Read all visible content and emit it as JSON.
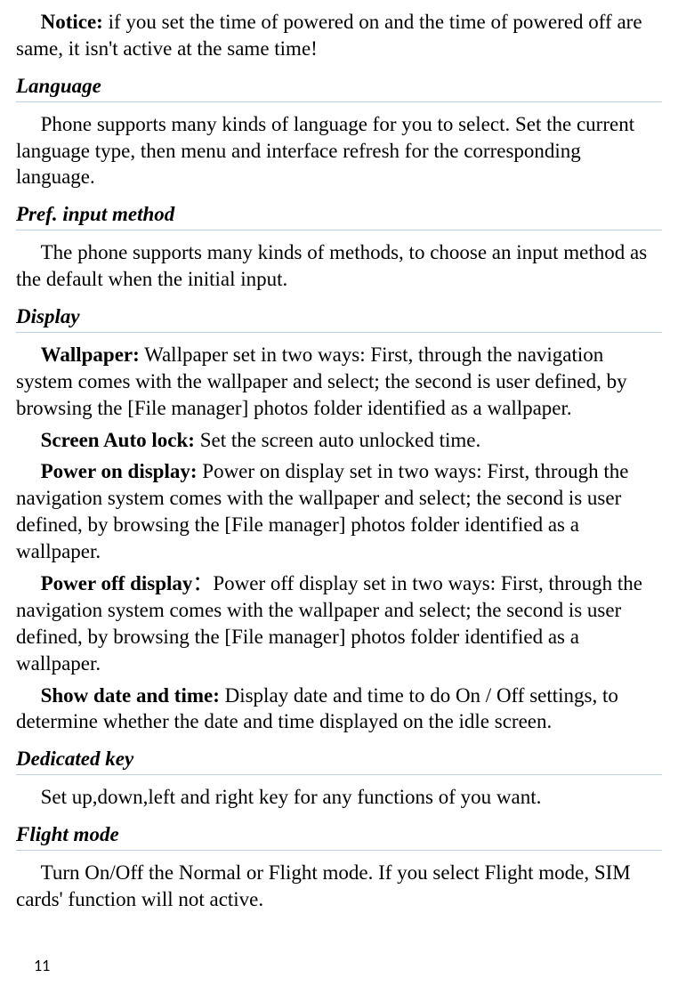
{
  "notice": {
    "label": "Notice:",
    "text": " if you set the time of powered on and the time of powered off are same, it isn't active at the same time!"
  },
  "language": {
    "heading": "Language",
    "text": "Phone supports many kinds of language for you to select. Set the current language type, then menu and interface refresh for the corresponding language."
  },
  "pref_input": {
    "heading": "Pref. input method",
    "text": "The phone supports many kinds of methods, to choose an input method as the default when the initial input."
  },
  "display": {
    "heading": "Display",
    "wallpaper_label": "Wallpaper:",
    "wallpaper_text": "   Wallpaper set in two ways: First, through the navigation system comes with the wallpaper and select; the second is user defined, by browsing the [File manager] photos folder identified as a wallpaper.",
    "autolock_label": "Screen Auto lock:",
    "autolock_text": "   Set the screen auto unlocked time.",
    "poweron_label": "Power on display:",
    "poweron_text": "   Power on display set in two ways: First, through the navigation system comes with the wallpaper and select; the second is user defined, by browsing the [File manager] photos folder identified as a wallpaper.",
    "poweroff_label": "Power off display",
    "poweroff_text": "：Power off display set in two ways: First, through the navigation system comes with the wallpaper and select; the second is user defined, by browsing the [File manager] photos folder identified as a wallpaper.",
    "showdate_label": "Show date and time:",
    "showdate_text": "   Display date and time to do On / Off settings, to determine whether the date and time displayed on the idle screen."
  },
  "dedicated": {
    "heading": "Dedicated key",
    "text": "Set up,down,left and right key for any functions of you want."
  },
  "flight": {
    "heading": "Flight mode",
    "text": "Turn On/Off the Normal or Flight mode. If you select Flight mode, SIM cards' function will not active."
  },
  "page_number": "11"
}
